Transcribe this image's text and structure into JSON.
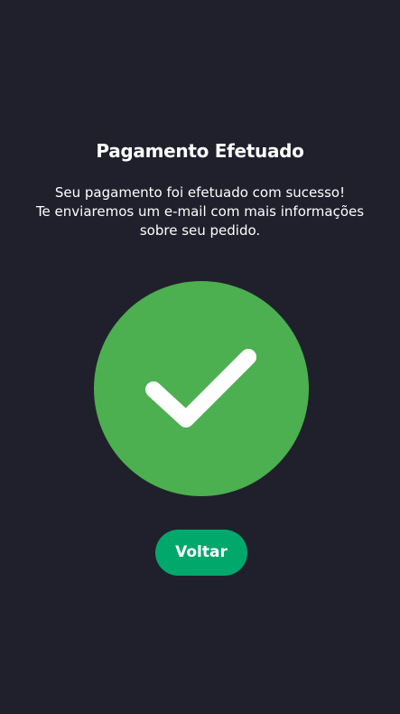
{
  "page": {
    "title": "Pagamento Efetuado",
    "message_lines": [
      "Seu pagamento foi efetuado com sucesso!",
      "Te enviaremos um e-mail com mais informações",
      "sobre seu pedido."
    ],
    "status_icon": "checkmark-circle-icon",
    "back_button_label": "Voltar"
  },
  "colors": {
    "background": "#20202c",
    "success_circle": "#4caf50",
    "button": "#00a86b",
    "text": "#ffffff"
  }
}
